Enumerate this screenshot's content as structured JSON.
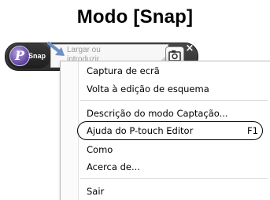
{
  "title": "Modo [Snap]",
  "toolbar": {
    "logo_text": "Snap",
    "logo_glyph": "P",
    "drop_placeholder": "Largar ou\nintroduzir",
    "close_glyph": "×"
  },
  "menu": {
    "items": [
      {
        "label": "Captura de ecrã"
      },
      {
        "label": "Volta à edição de esquema"
      },
      {
        "label": "Descrição do modo Captação..."
      },
      {
        "label": "Ajuda do P-touch Editor",
        "shortcut": "F1"
      },
      {
        "label": "Como"
      },
      {
        "label": "Acerca de..."
      },
      {
        "label": "Sair"
      }
    ]
  }
}
